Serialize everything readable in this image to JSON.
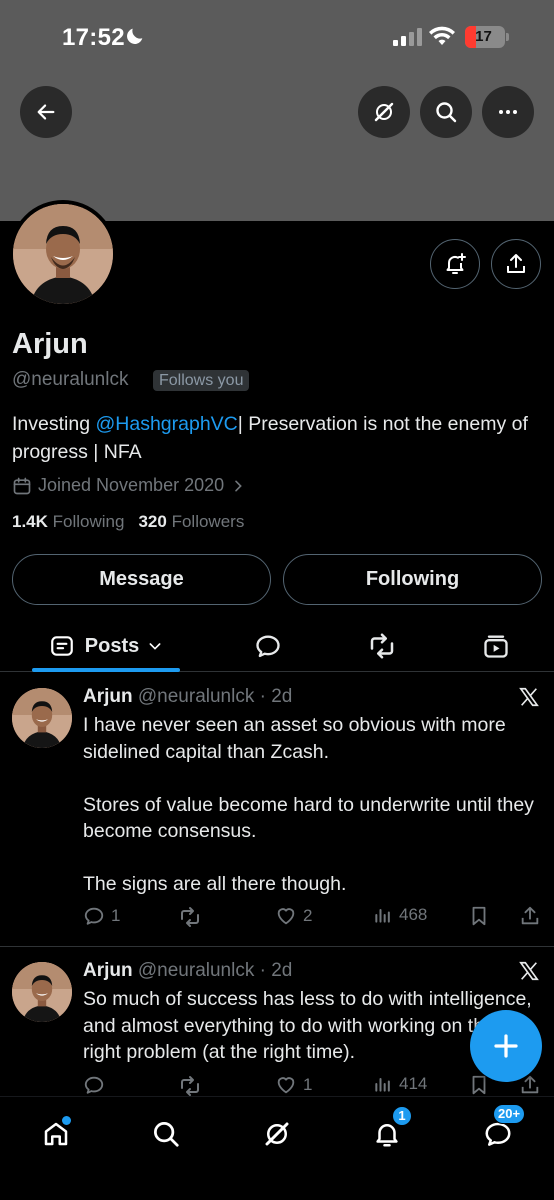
{
  "status_bar": {
    "time": "17:52",
    "battery": "17"
  },
  "profile": {
    "name": "Arjun",
    "handle": "@neuralunlck",
    "follows_you": "Follows you",
    "bio_prefix": "Investing ",
    "bio_mention": "@HashgraphVC",
    "bio_suffix": "| Preservation is not the enemy of progress | NFA",
    "joined": "Joined November 2020",
    "following_count": "1.4K",
    "following_label": "Following",
    "followers_count": "320",
    "followers_label": "Followers"
  },
  "buttons": {
    "message": "Message",
    "following": "Following"
  },
  "tabs": {
    "posts": "Posts"
  },
  "tweets": [
    {
      "name": "Arjun",
      "meta": "@neuralunlck · 2d",
      "text": "I have never seen an asset so obvious with more sidelined capital than Zcash.\n\nStores of value become hard to underwrite until they become consensus.\n\nThe signs are all there though.",
      "replies": "1",
      "likes": "2",
      "views": "468"
    },
    {
      "name": "Arjun",
      "meta": "@neuralunlck · 2d",
      "text": "So much of success has less to do with intelligence, and almost everything to do with working on the right problem (at the right time).",
      "likes": "1",
      "views": "414"
    }
  ],
  "nav": {
    "notifications_badge": "1",
    "messages_badge": "20+"
  },
  "colors": {
    "accent": "#1d9bf0",
    "banner": "#5b5b5b",
    "muted": "#71767b"
  },
  "icons": [
    "back-arrow-icon",
    "grok-icon",
    "search-icon",
    "more-icon",
    "notify-add-icon",
    "share-icon",
    "calendar-icon",
    "chevron-right-icon",
    "posts-icon",
    "chevron-down-icon",
    "reply-icon",
    "repost-icon",
    "media-icon",
    "like-icon",
    "views-icon",
    "bookmark-icon",
    "x-logo-icon",
    "plus-icon",
    "home-icon",
    "bell-icon",
    "mail-icon"
  ]
}
